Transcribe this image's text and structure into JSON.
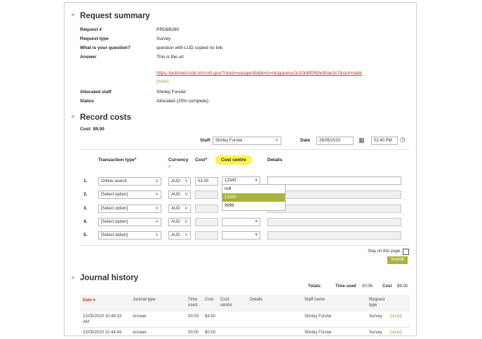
{
  "request_summary": {
    "title": "Request summary",
    "fields": [
      {
        "label": "Request #",
        "value": "PRO88290"
      },
      {
        "label": "Request type",
        "value": "Survey"
      },
      {
        "label": "What is your question?",
        "value": "question with LUD copied no link"
      },
      {
        "label": "Answer",
        "value": "This is the url"
      }
    ],
    "answer_link": "https://pubmed.ncbi.nlm.nih.gov/?otool=wasgenlib&term=longqueryc3c10d8f0f69e90ae3c7&sort=date",
    "more": "[more]",
    "allocated_label": "Allocated staff",
    "allocated_value": "Shirley Forster",
    "status_label": "Status",
    "status_value": "Allocated (25% complete)"
  },
  "record_costs": {
    "title": "Record costs",
    "cost_line": "Cost: $9.00",
    "staff_label": "Staff",
    "staff_value": "Shirley Forster",
    "date_label": "Date",
    "date_value": "26/05/2020",
    "time_value": "02:40 PM",
    "headers": {
      "transaction_type": "Transaction type",
      "currency": "Currency",
      "cost": "Cost",
      "cost_centre": "Cost centre",
      "details": "Details",
      "required": "*"
    },
    "rows": [
      {
        "num": "1.",
        "type": "Online search",
        "currency": "AUD",
        "cost": "03.00",
        "cost_centre": "12345"
      },
      {
        "num": "2.",
        "type": "[Select option]",
        "currency": "AUD",
        "cost": "",
        "cost_centre": ""
      },
      {
        "num": "3.",
        "type": "[Select option]",
        "currency": "AUD",
        "cost": "",
        "cost_centre": ""
      },
      {
        "num": "4.",
        "type": "[Select option]",
        "currency": "AUD",
        "cost": "",
        "cost_centre": ""
      },
      {
        "num": "5.",
        "type": "[Select option]",
        "currency": "AUD",
        "cost": "",
        "cost_centre": ""
      }
    ],
    "cost_centre_options": [
      "null",
      "12345",
      "9999"
    ],
    "cost_centre_selected": "12345",
    "stay_on_page": "Stay on this page",
    "submit": "Submit"
  },
  "journal": {
    "title": "Journal history",
    "totals_label": "Totals:",
    "time_used_label": "Time used",
    "time_used_value": "00:06",
    "cost_label": "Cost",
    "cost_value": "$9.00",
    "columns": {
      "date": "Date",
      "journal_type": "Journal type",
      "time_used_1": "Time",
      "time_used_2": "used",
      "cost": "Cost",
      "cost_centre_1": "Cost",
      "cost_centre_2": "centre",
      "details": "Details",
      "staff": "Staff name",
      "request_type_1": "Request",
      "request_type_2": "type"
    },
    "rows": [
      {
        "date_1": "22/05/2020 10:49:33",
        "date_2": "AM",
        "type": "Answer",
        "time": "00:03",
        "cost": "$4.50",
        "staff": "Shirley Forster",
        "request_type": "Survey",
        "undo": "[undo]"
      },
      {
        "date_1": "22/05/2020 10:44:49",
        "date_2": "",
        "type": "Answer",
        "time": "00:00",
        "cost": "$0.00",
        "staff": "Shirley Forster",
        "request_type": "Survey",
        "undo": "[undo]"
      }
    ]
  },
  "colors": {
    "accent": "#a9b23a",
    "highlight": "#fdf34a",
    "link": "#c0392b",
    "required": "#d0021b"
  }
}
